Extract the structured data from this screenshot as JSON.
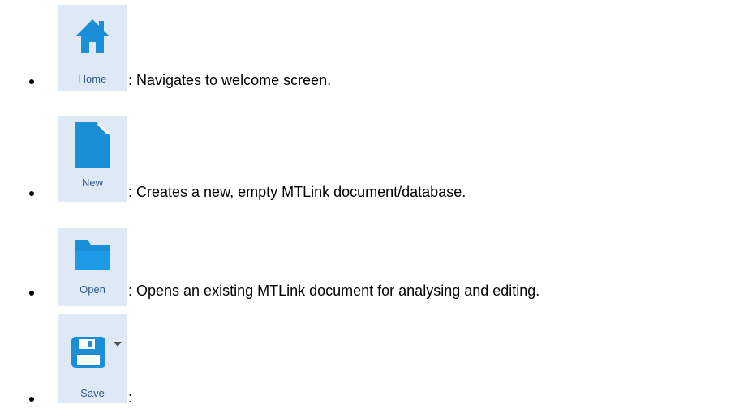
{
  "colors": {
    "tile_bg": "#dfe9f5",
    "icon_blue": "#1a8fd8",
    "label_text": "#2f5b8e"
  },
  "items": [
    {
      "icon": "home-icon",
      "label": "Home",
      "description": ": Navigates to welcome screen."
    },
    {
      "icon": "new-document-icon",
      "label": "New",
      "description": ": Creates a new, empty MTLink document/database."
    },
    {
      "icon": "open-folder-icon",
      "label": "Open",
      "description": ": Opens an existing MTLink document for analysing and editing."
    },
    {
      "icon": "save-disk-icon",
      "label": "Save",
      "description": ":",
      "has_dropdown": true
    }
  ]
}
